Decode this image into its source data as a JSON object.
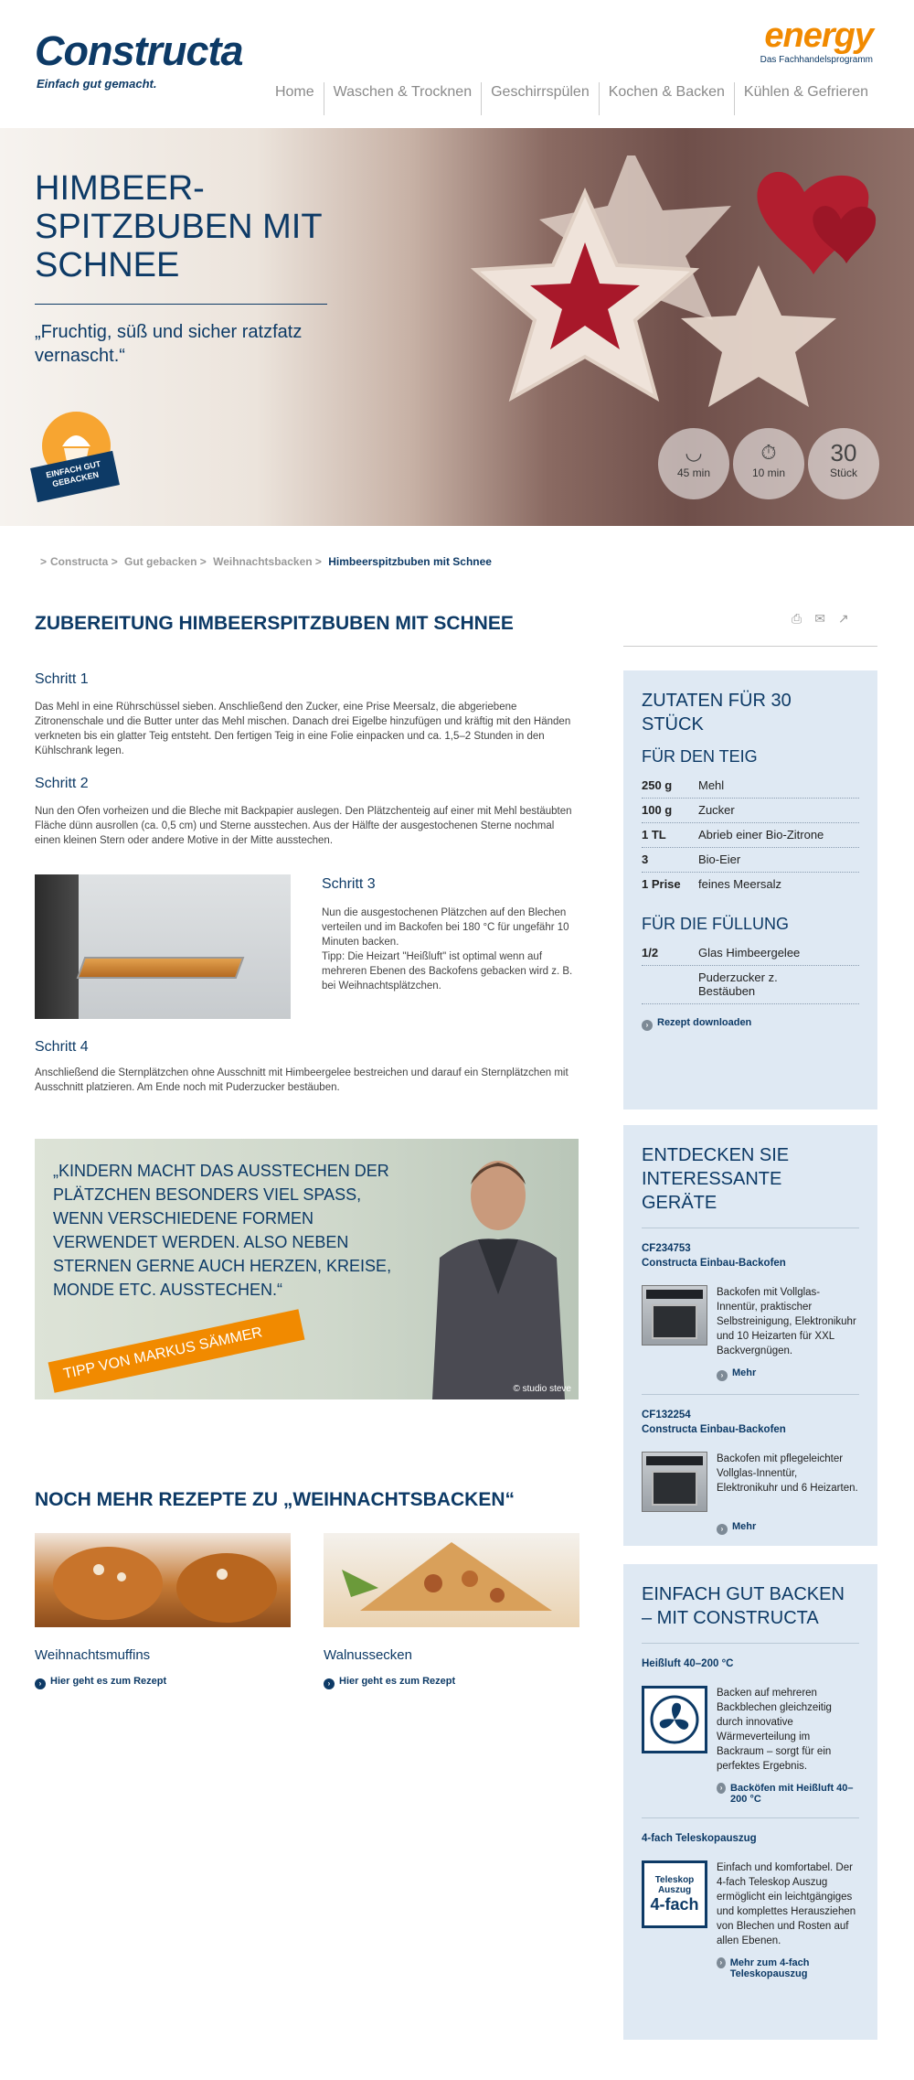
{
  "header": {
    "logo": "Constructa",
    "tagline": "Einfach gut gemacht.",
    "energy_logo": "energy",
    "energy_sub": "Das Fachhandelsprogramm",
    "nav": [
      "Home",
      "Waschen & Trocknen",
      "Geschirrspülen",
      "Kochen & Backen",
      "Kühlen & Gefrieren"
    ]
  },
  "hero": {
    "title": "HIMBEER-SPITZBUBEN MIT SCHNEE",
    "quote": "„Fruchtig, süß und sicher ratzfatz vernascht.“",
    "badge": "EINFACH GUT GEBACKEN",
    "stats": [
      {
        "icon": "bowl-icon",
        "value": "45 min"
      },
      {
        "icon": "stopwatch-icon",
        "value": "10 min"
      },
      {
        "big": "30",
        "value": "Stück"
      }
    ]
  },
  "breadcrumb": [
    "Constructa",
    "Gut gebacken",
    "Weihnachtsbacken",
    "Himbeerspitzbuben mit Schnee"
  ],
  "main": {
    "title": "ZUBEREITUNG HIMBEERSPITZBUBEN MIT SCHNEE",
    "steps": [
      {
        "title": "Schritt 1",
        "text": "Das Mehl in eine Rührschüssel sieben. Anschließend den Zucker, eine Prise Meersalz, die abgeriebene Zitronenschale und die Butter unter das Mehl mischen. Danach drei Eigelbe hinzufügen und kräftig mit den Händen verkneten bis ein glatter Teig entsteht. Den fertigen Teig in eine Folie einpacken und ca. 1,5–2 Stunden in den Kühlschrank legen."
      },
      {
        "title": "Schritt 2",
        "text": "Nun den Ofen vorheizen und die Bleche mit Backpapier auslegen. Den Plätzchenteig auf einer mit Mehl bestäubten Fläche dünn ausrollen (ca. 0,5 cm) und Sterne ausstechen. Aus der Hälfte der ausgestochenen Sterne nochmal einen kleinen Stern oder andere Motive in der Mitte ausstechen."
      },
      {
        "title": "Schritt 3",
        "text": "Nun die ausgestochenen Plätzchen auf den Blechen verteilen und im Backofen bei 180 °C für ungefähr 10 Minuten backen.",
        "tip": "Tipp: Die Heizart \"Heißluft\" ist optimal wenn auf mehreren Ebenen des Backofens gebacken wird z. B. bei Weihnachtsplätzchen."
      },
      {
        "title": "Schritt 4",
        "text": "Anschließend die Sternplätzchen ohne Ausschnitt mit Himbeergelee bestreichen und darauf ein Sternplätzchen mit Ausschnitt platzieren. Am Ende noch mit Puderzucker bestäuben."
      }
    ],
    "tip_quote": "„KINDERN MACHT DAS AUSSTECHEN DER PLÄTZCHEN BESONDERS VIEL SPASS, WENN VERSCHIEDENE FORMEN VERWENDET WERDEN. ALSO NEBEN STERNEN GERNE AUCH HERZEN, KREISE, MONDE ETC. AUSSTECHEN.“",
    "tip_band": "TIPP VON MARKUS SÄMMER",
    "tip_credit": "© studio steve",
    "more_title": "NOCH MEHR REZEPTE ZU „WEIHNACHTSBACKEN“",
    "recipes": [
      {
        "name": "Weihnachtsmuffins",
        "link": "Hier geht es zum Rezept"
      },
      {
        "name": "Walnussecken",
        "link": "Hier geht es zum Rezept"
      }
    ]
  },
  "sidebar": {
    "ingredients_title": "ZUTATEN FÜR 30 STÜCK",
    "dough_title": "FÜR DEN TEIG",
    "dough": [
      {
        "q": "250 g",
        "n": "Mehl"
      },
      {
        "q": "100 g",
        "n": "Zucker"
      },
      {
        "q": "1 TL",
        "n": "Abrieb einer Bio-Zitrone"
      },
      {
        "q": "3",
        "n": "Bio-Eier"
      },
      {
        "q": "1 Prise",
        "n": "feines Meersalz"
      }
    ],
    "filling_title": "FÜR DIE FÜLLUNG",
    "filling": [
      {
        "q": "1/2",
        "n": "Glas Himbeergelee"
      },
      {
        "q": "",
        "n": "Puderzucker z. Bestäuben"
      }
    ],
    "download": "Rezept downloaden",
    "devices_title": "ENTDECKEN SIE INTERESSANTE GERÄTE",
    "devices": [
      {
        "id": "CF234753",
        "name": "Constructa Einbau-Backofen",
        "text": "Backofen mit Vollglas-Innentür, praktischer Selbstreinigung, Elektronikuhr und 10 Heizarten für XXL Backvergnügen.",
        "more": "Mehr"
      },
      {
        "id": "CF132254",
        "name": "Constructa Einbau-Backofen",
        "text": "Backofen mit pflegeleichter Vollglas-Innentür, Elektronikuhr und 6 Heizarten.",
        "more": "Mehr"
      }
    ],
    "features_title": "EINFACH GUT BACKEN – MIT CONSTRUCTA",
    "features": [
      {
        "title": "Heißluft 40–200 °C",
        "text": "Backen auf mehreren Backblechen gleichzeitig durch innovative Wärmeverteilung im Backraum – sorgt für ein perfektes Ergebnis.",
        "link": "Backöfen mit Heißluft 40–200 °C",
        "icon": "fan-icon"
      },
      {
        "title": "4-fach Teleskopauszug",
        "text": "Einfach und komfortabel. Der 4-fach Teleskop Auszug ermöglicht ein leichtgängiges und komplettes Herausziehen von Blechen und Rosten auf allen Ebenen.",
        "link": "Mehr zum 4-fach Teleskopauszug",
        "icon_label_1": "Teleskop Auszug",
        "icon_label_2": "4-fach"
      }
    ]
  }
}
